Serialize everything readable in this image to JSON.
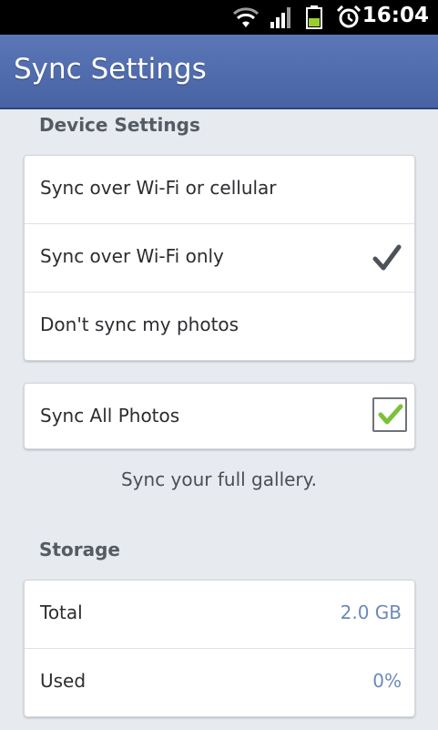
{
  "status_bar": {
    "time": "16:04",
    "icons": [
      "wifi-icon",
      "signal-icon",
      "battery-icon",
      "alarm-icon"
    ]
  },
  "app_bar": {
    "title": "Sync Settings"
  },
  "device_settings": {
    "header": "Device Settings",
    "options": [
      {
        "label": "Sync over Wi-Fi or cellular",
        "selected": false
      },
      {
        "label": "Sync over Wi-Fi only",
        "selected": true
      },
      {
        "label": "Don't sync my photos",
        "selected": false
      }
    ]
  },
  "sync_all": {
    "label": "Sync All Photos",
    "checked": true,
    "caption": "Sync your full gallery."
  },
  "storage": {
    "header": "Storage",
    "rows": [
      {
        "label": "Total",
        "value": "2.0 GB"
      },
      {
        "label": "Used",
        "value": "0%"
      }
    ]
  },
  "colors": {
    "app_bar": "#4f6aac",
    "check_green": "#7cc13a",
    "value_blue": "#6c89b8"
  }
}
